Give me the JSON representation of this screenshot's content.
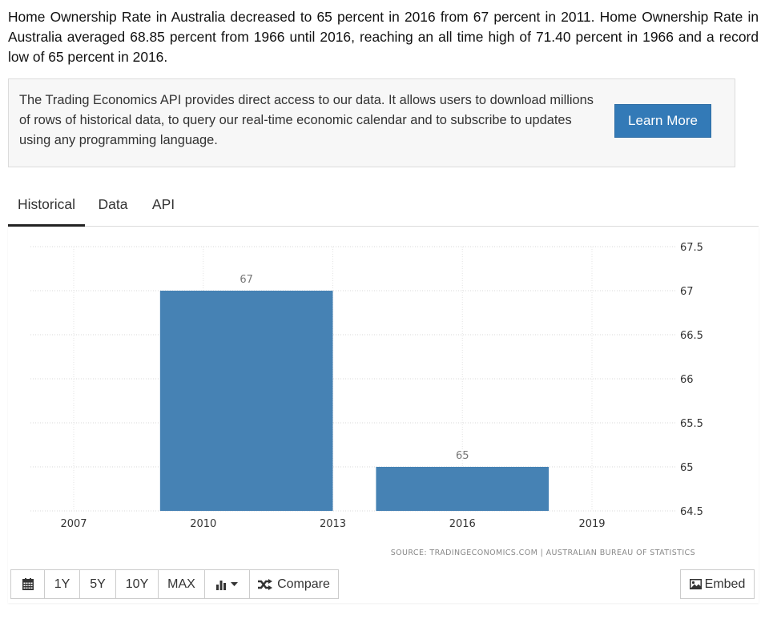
{
  "description": "Home Ownership Rate in Australia decreased to 65 percent in 2016 from 67 percent in 2011. Home Ownership Rate in Australia averaged 68.85 percent from 1966 until 2016, reaching an all time high of 71.40 percent in 1966 and a record low of 65 percent in 2016.",
  "api_promo": {
    "text": "The Trading Economics API provides direct access to our data. It allows users to download millions of rows of historical data, to query our real-time economic calendar and to subscribe to updates using any programming language.",
    "button_label": "Learn More",
    "button_color": "#337ab7"
  },
  "tabs": [
    {
      "label": "Historical",
      "active": true
    },
    {
      "label": "Data",
      "active": false
    },
    {
      "label": "API",
      "active": false
    }
  ],
  "toolbar": {
    "calendar_icon": "calendar-icon",
    "buttons": [
      "1Y",
      "5Y",
      "10Y",
      "MAX"
    ],
    "chart_type_icon": "bar-chart-icon",
    "compare_icon": "shuffle-icon",
    "compare_label": "Compare",
    "embed_icon": "image-icon",
    "embed_label": "Embed"
  },
  "chart_data": {
    "type": "bar",
    "title": "",
    "xlabel": "",
    "ylabel": "",
    "bar_color": "#4682b4",
    "categories": [
      "2011",
      "2016"
    ],
    "x": [
      2011,
      2016
    ],
    "values": [
      67,
      65
    ],
    "data_labels": [
      "67",
      "65"
    ],
    "xlim": [
      2005,
      2021
    ],
    "ylim": [
      64.5,
      67.5
    ],
    "x_ticks": [
      2007,
      2010,
      2013,
      2016,
      2019
    ],
    "x_tick_labels": [
      "2007",
      "2010",
      "2013",
      "2016",
      "2019"
    ],
    "y_ticks": [
      64.5,
      65,
      65.5,
      66,
      66.5,
      67,
      67.5
    ],
    "y_tick_labels": [
      "64.5",
      "65",
      "65.5",
      "66",
      "66.5",
      "67",
      "67.5"
    ],
    "y_axis_side": "right",
    "grid": true,
    "legend": "none",
    "source": "SOURCE: TRADINGECONOMICS.COM  |  AUSTRALIAN BUREAU OF STATISTICS"
  }
}
